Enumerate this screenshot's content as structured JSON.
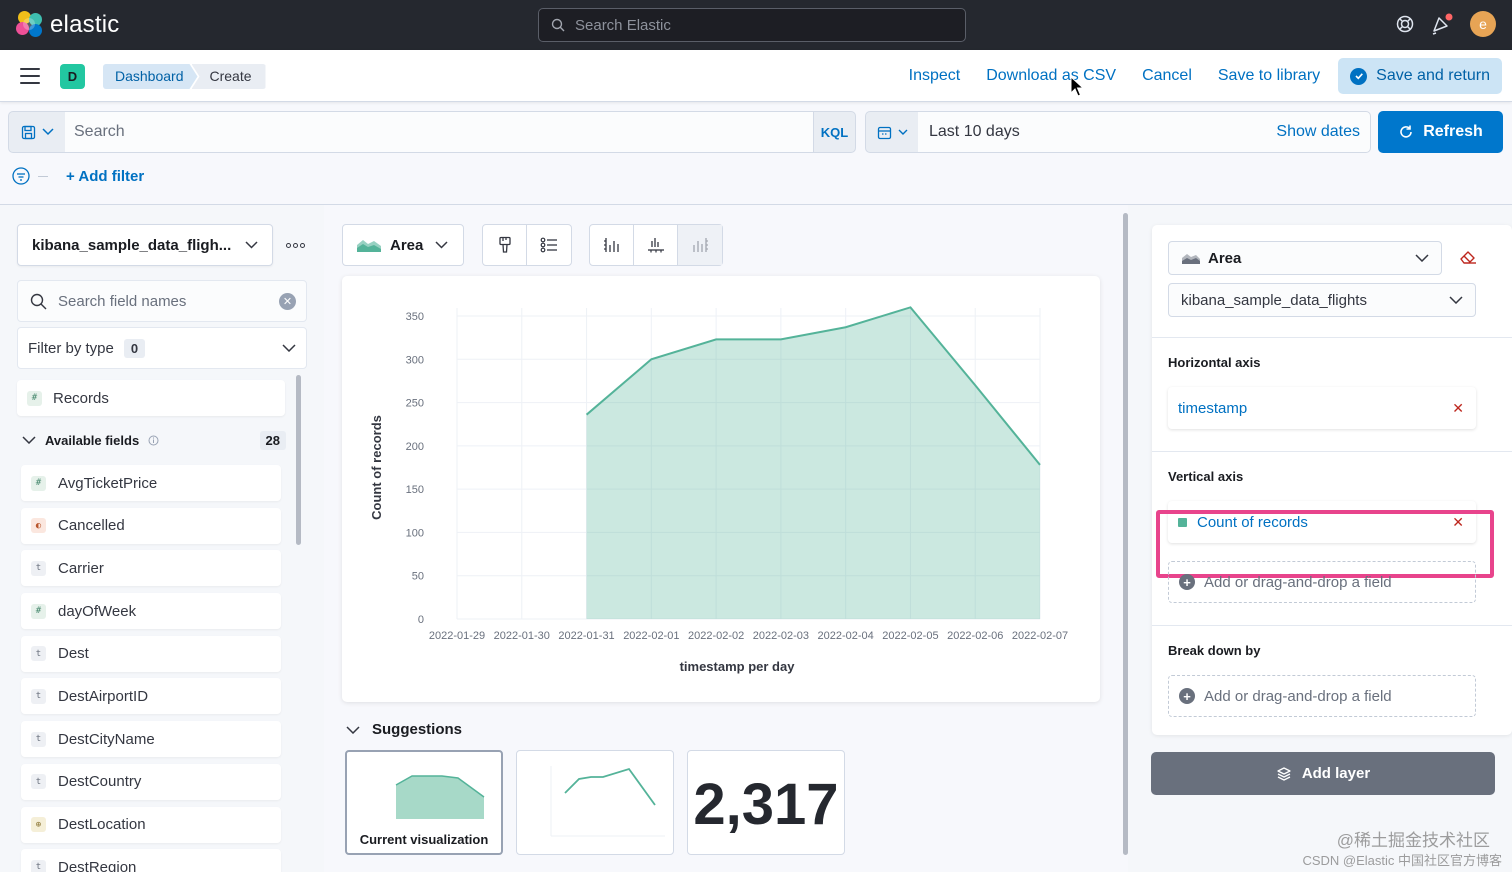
{
  "header": {
    "logo_text": "elastic",
    "search_placeholder": "Search Elastic",
    "avatar_letter": "e"
  },
  "appbar": {
    "space_initial": "D",
    "breadcrumbs": [
      "Dashboard",
      "Create"
    ],
    "actions": {
      "inspect": "Inspect",
      "download_csv": "Download as CSV",
      "cancel": "Cancel",
      "save_library": "Save to library",
      "save_return": "Save and return"
    }
  },
  "query": {
    "search_placeholder": "Search",
    "language": "KQL",
    "time_range": "Last 10 days",
    "show_dates": "Show dates",
    "refresh": "Refresh",
    "add_filter": "+ Add filter"
  },
  "fields_panel": {
    "index_pattern": "kibana_sample_data_fligh...",
    "search_placeholder": "Search field names",
    "filter_by_type": "Filter by type",
    "filter_count": "0",
    "records": "Records",
    "available_label": "Available fields",
    "available_count": "28",
    "fields": [
      {
        "name": "AvgTicketPrice",
        "type": "number",
        "glyph": "#"
      },
      {
        "name": "Cancelled",
        "type": "boolean",
        "glyph": "◐"
      },
      {
        "name": "Carrier",
        "type": "string",
        "glyph": "t"
      },
      {
        "name": "dayOfWeek",
        "type": "number",
        "glyph": "#"
      },
      {
        "name": "Dest",
        "type": "string",
        "glyph": "t"
      },
      {
        "name": "DestAirportID",
        "type": "string",
        "glyph": "t"
      },
      {
        "name": "DestCityName",
        "type": "string",
        "glyph": "t"
      },
      {
        "name": "DestCountry",
        "type": "string",
        "glyph": "t"
      },
      {
        "name": "DestLocation",
        "type": "geo",
        "glyph": "⊕"
      },
      {
        "name": "DestRegion",
        "type": "string",
        "glyph": "t"
      }
    ]
  },
  "workspace": {
    "chart_type_label": "Area",
    "suggestions_title": "Suggestions",
    "suggestion_current": "Current visualization",
    "suggestion_metric": "2,317"
  },
  "chart_data": {
    "type": "area",
    "x": [
      "2022-01-29",
      "2022-01-30",
      "2022-01-31",
      "2022-02-01",
      "2022-02-02",
      "2022-02-03",
      "2022-02-04",
      "2022-02-05",
      "2022-02-06",
      "2022-02-07"
    ],
    "values": [
      null,
      null,
      236,
      300,
      323,
      323,
      337,
      360,
      270,
      178
    ],
    "ylabel": "Count of records",
    "xlabel": "timestamp per day",
    "ylim": [
      0,
      350
    ],
    "yticks": [
      0,
      50,
      100,
      150,
      200,
      250,
      300,
      350
    ],
    "grid": true,
    "color": "#54b399"
  },
  "config_panel": {
    "chart_type": "Area",
    "index_pattern": "kibana_sample_data_flights",
    "horizontal_axis_heading": "Horizontal axis",
    "horizontal_field": "timestamp",
    "vertical_axis_heading": "Vertical axis",
    "vertical_field": "Count of records",
    "add_field_placeholder": "Add or drag-and-drop a field",
    "breakdown_heading": "Break down by",
    "add_layer": "Add layer"
  },
  "watermark": {
    "line1": "@稀土掘金技术社区",
    "line2": "CSDN @Elastic 中国社区官方博客"
  },
  "colors": {
    "accent": "#0077cc",
    "highlight": "#e8448c",
    "series": "#54b399"
  }
}
